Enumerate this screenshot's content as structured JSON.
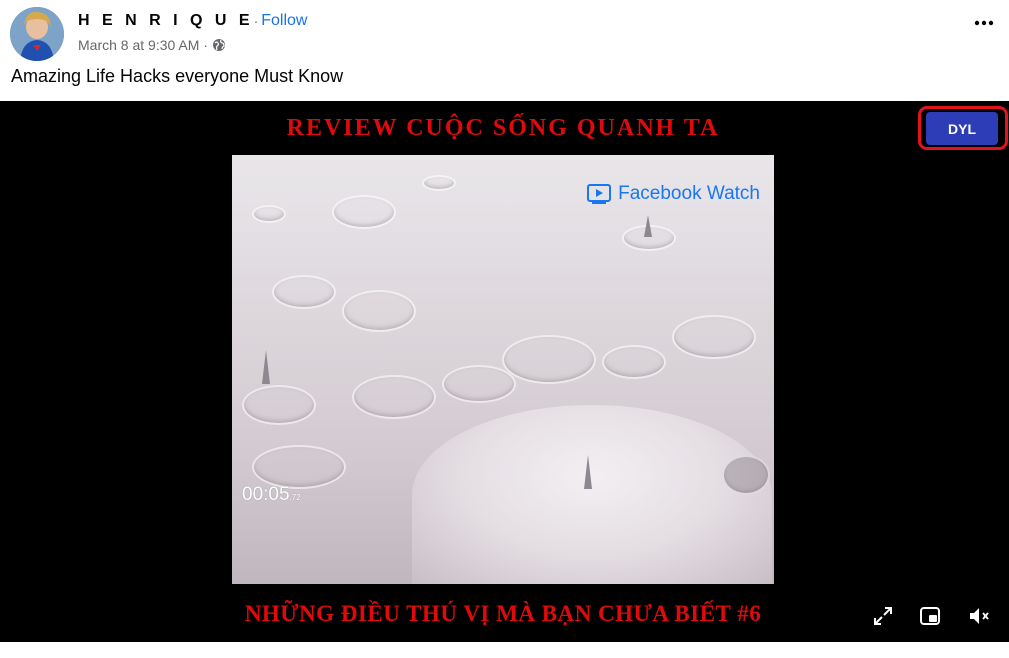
{
  "post": {
    "author": "H E N R I Q U E",
    "dot": "·",
    "follow_label": "Follow",
    "date": "March 8 at 9:30 AM",
    "date_sep": "·",
    "caption": "Amazing Life Hacks everyone Must Know",
    "more_label": "•••"
  },
  "video": {
    "top_banner": "REVIEW CUỘC SỐNG QUANH TA",
    "bottom_banner": "NHỮNG ĐIỀU THÚ VỊ MÀ BẠN CHƯA BIẾT #6",
    "watermark": "Facebook Watch",
    "timer_main": "00:05",
    "timer_small": ".72",
    "dyl_label": "DYL",
    "controls": [
      "expand-icon",
      "miniplayer-icon",
      "mute-icon"
    ]
  },
  "colors": {
    "follow_blue": "#1b74e4",
    "banner_red": "#e00a0a",
    "dyl_blue": "#2d3db7",
    "highlight_red": "#e3131c",
    "fb_watch_blue": "#1877f2"
  }
}
